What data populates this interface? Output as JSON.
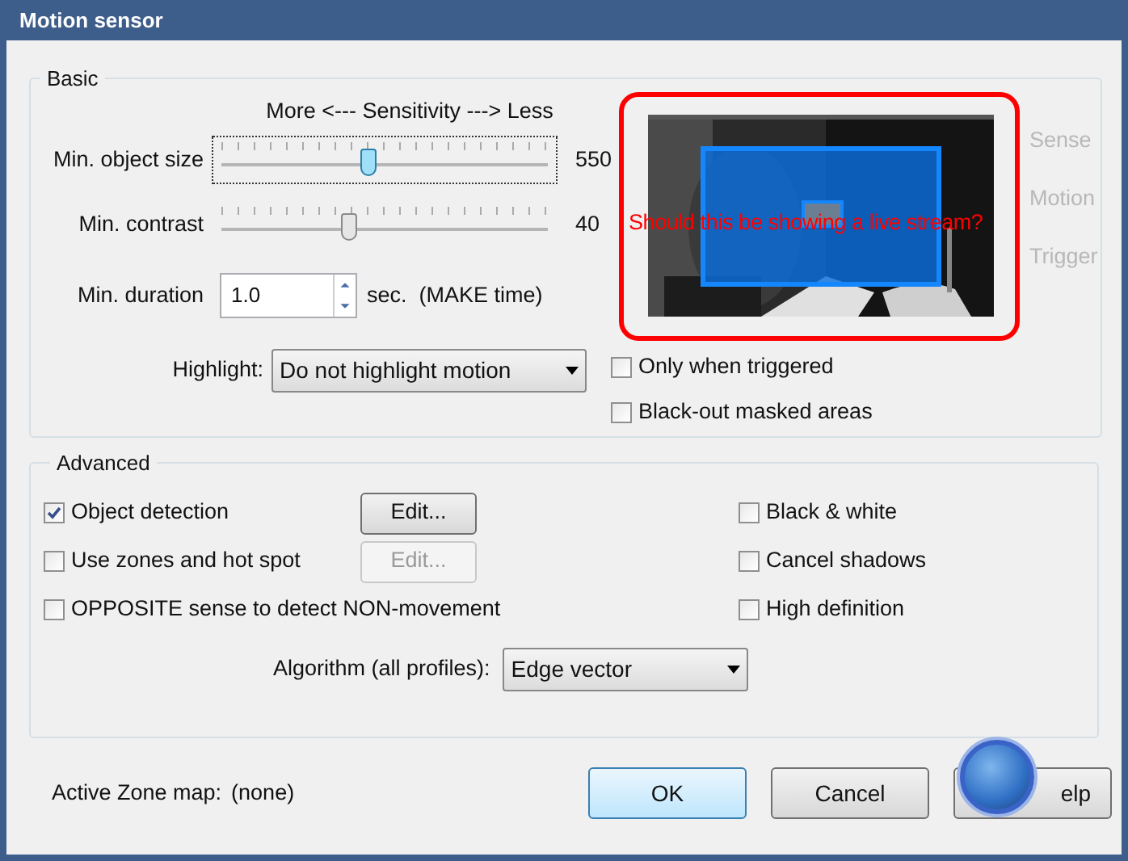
{
  "window": {
    "title": "Motion sensor"
  },
  "basic": {
    "title": "Basic",
    "sensitivity_caption": "More <--- Sensitivity ---> Less",
    "sliders": [
      {
        "label": "Min. object size",
        "level": 0.45,
        "value": "550",
        "focused": true
      },
      {
        "label": "Min. contrast",
        "level": 0.39,
        "value": "40",
        "focused": false
      }
    ],
    "duration": {
      "label": "Min. duration",
      "value": "1.0",
      "unit": "sec.  (MAKE time)"
    },
    "highlight": {
      "label": "Highlight:",
      "value": "Do not highlight motion"
    },
    "preview": {
      "kind": "picture",
      "overlay_text": "Should this be showing a live stream?"
    },
    "indicators": [
      {
        "label": "Sense",
        "active": false
      },
      {
        "label": "Motion",
        "active": false
      },
      {
        "label": "Trigger",
        "active": false
      }
    ],
    "options": [
      {
        "label": "Only when triggered",
        "checked": false
      },
      {
        "label": "Black-out masked areas",
        "checked": false
      }
    ]
  },
  "advanced": {
    "title": "Advanced",
    "left_options": [
      {
        "label": "Object detection",
        "checked": true,
        "button": {
          "label": "Edit...",
          "disabled": false
        }
      },
      {
        "label": "Use zones and hot spot",
        "checked": false,
        "button": {
          "label": "Edit...",
          "disabled": true
        }
      },
      {
        "label": "OPPOSITE sense to detect NON-movement",
        "checked": false
      }
    ],
    "right_options": [
      {
        "label": "Black & white",
        "checked": false
      },
      {
        "label": "Cancel shadows",
        "checked": false
      },
      {
        "label": "High definition",
        "checked": false
      }
    ],
    "algorithm": {
      "label": "Algorithm (all profiles):",
      "value": "Edge vector"
    }
  },
  "footer": {
    "zone_map_label": "Active Zone map:",
    "zone_map_value": "(none)",
    "buttons": [
      {
        "label": "OK",
        "default": true
      },
      {
        "label": "Cancel",
        "default": false
      },
      {
        "label": "elp",
        "default": false,
        "covered": true
      }
    ]
  }
}
